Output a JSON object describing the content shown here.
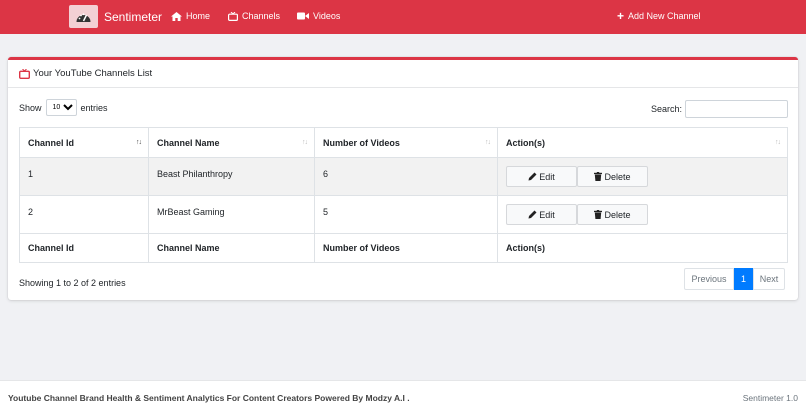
{
  "navbar": {
    "brand": "Sentimeter",
    "links": [
      {
        "label": "Home",
        "icon": "home-icon"
      },
      {
        "label": "Channels",
        "icon": "tv-icon"
      },
      {
        "label": "Videos",
        "icon": "video-camera-icon"
      }
    ],
    "add_channel_label": "Add New Channel"
  },
  "card": {
    "title": "Your YouTube Channels List"
  },
  "table_controls": {
    "show_label": "Show",
    "entries_value": "10",
    "entries_label": "entries",
    "search_label": "Search:",
    "search_value": ""
  },
  "table": {
    "columns": [
      "Channel Id",
      "Channel Name",
      "Number of Videos",
      "Action(s)"
    ],
    "rows": [
      {
        "id": "1",
        "name": "Beast Philanthropy",
        "videos": "6"
      },
      {
        "id": "2",
        "name": "MrBeast Gaming",
        "videos": "5"
      }
    ],
    "edit_label": "Edit",
    "delete_label": "Delete"
  },
  "pagination": {
    "info": "Showing 1 to 2 of 2 entries",
    "previous": "Previous",
    "current": "1",
    "next": "Next"
  },
  "footer": {
    "text": "Youtube Channel Brand Health & Sentiment Analytics For Content Creators Powered By Modzy A.I .",
    "version": "Sentimeter 1.0"
  },
  "colors": {
    "navbar": "#dc3545",
    "accent": "#dc3545",
    "page_active": "#007bff"
  }
}
